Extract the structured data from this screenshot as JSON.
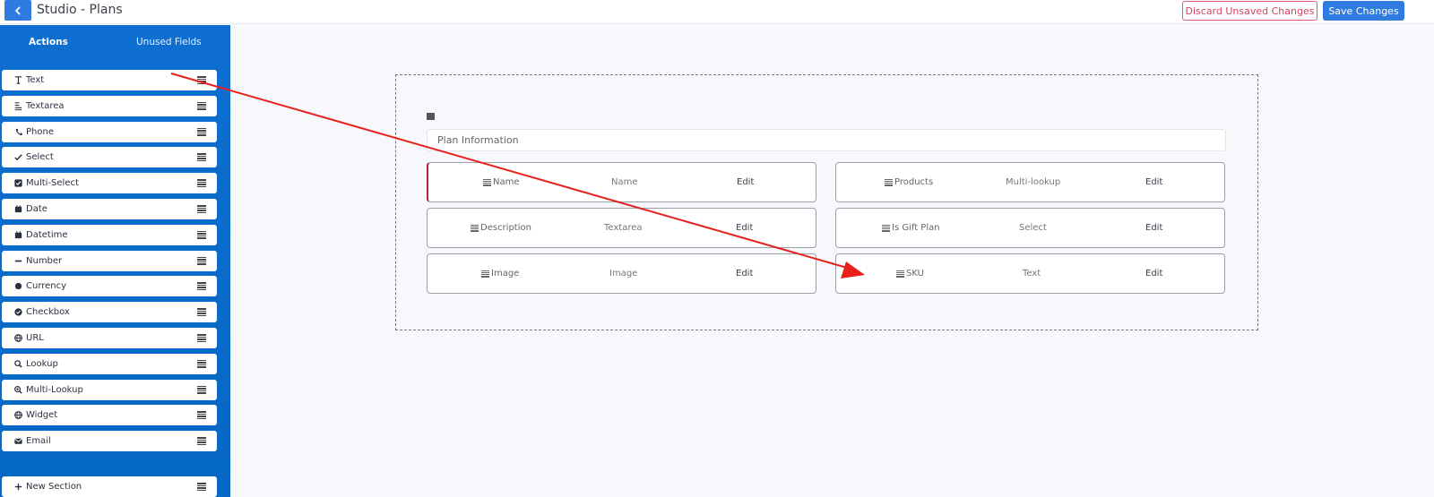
{
  "header": {
    "title": "Studio - Plans",
    "discard_label": "Discard Unsaved Changes",
    "save_label": "Save Changes"
  },
  "sidebar": {
    "tabs": [
      {
        "label": "Actions",
        "active": true
      },
      {
        "label": "Unused Fields",
        "active": false
      }
    ],
    "field_types": [
      {
        "label": "Text",
        "icon": "text-icon"
      },
      {
        "label": "Textarea",
        "icon": "textarea-icon"
      },
      {
        "label": "Phone",
        "icon": "phone-icon"
      },
      {
        "label": "Select",
        "icon": "check-icon"
      },
      {
        "label": "Multi-Select",
        "icon": "checkbox-checked-icon"
      },
      {
        "label": "Date",
        "icon": "calendar-icon"
      },
      {
        "label": "Datetime",
        "icon": "calendar-icon"
      },
      {
        "label": "Number",
        "icon": "minus-icon"
      },
      {
        "label": "Currency",
        "icon": "circle-icon"
      },
      {
        "label": "Checkbox",
        "icon": "check-circle-icon"
      },
      {
        "label": "URL",
        "icon": "globe-icon"
      },
      {
        "label": "Lookup",
        "icon": "search-icon"
      },
      {
        "label": "Multi-Lookup",
        "icon": "search-plus-icon"
      },
      {
        "label": "Widget",
        "icon": "globe-icon"
      },
      {
        "label": "Email",
        "icon": "envelope-icon"
      }
    ],
    "new_section_label": "New Section"
  },
  "section": {
    "title": "Plan Information",
    "fields": [
      {
        "name": "Name",
        "type": "Name",
        "edit": "Edit",
        "selected": true
      },
      {
        "name": "Products",
        "type": "Multi-lookup",
        "edit": "Edit",
        "selected": false
      },
      {
        "name": "Description",
        "type": "Textarea",
        "edit": "Edit",
        "selected": false
      },
      {
        "name": "Is Gift Plan",
        "type": "Select",
        "edit": "Edit",
        "selected": false
      },
      {
        "name": "Image",
        "type": "Image",
        "edit": "Edit",
        "selected": false
      },
      {
        "name": "SKU",
        "type": "Text",
        "edit": "Edit",
        "selected": false
      }
    ]
  },
  "colors": {
    "accent": "#2f7be0",
    "sidebar": "#0667c4",
    "danger": "#d9405f",
    "annotation_arrow": "#e8201c"
  }
}
